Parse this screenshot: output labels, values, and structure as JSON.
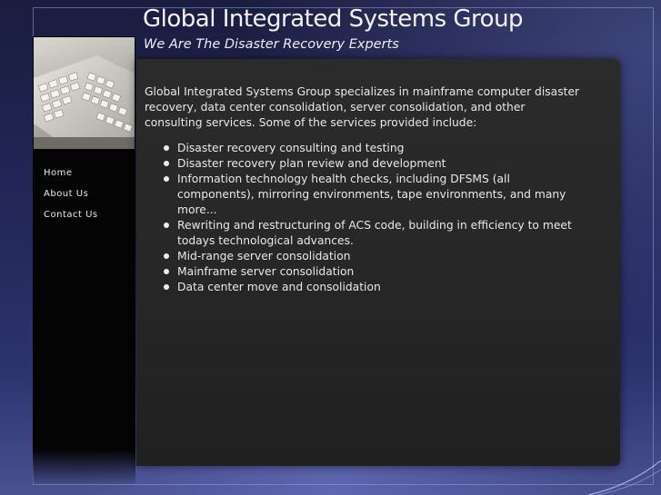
{
  "header": {
    "title": "Global Integrated Systems Group",
    "tagline": "We Are The Disaster Recovery Experts"
  },
  "sidebar": {
    "image": "keyboard-photo",
    "nav": [
      {
        "label": "Home"
      },
      {
        "label": "About Us"
      },
      {
        "label": "Contact Us"
      }
    ]
  },
  "main": {
    "intro": "Global Integrated Systems Group specializes in mainframe computer disaster recovery, data center consolidation, server consolidation, and other consulting services.  Some of the services provided include:",
    "services": [
      "Disaster recovery consulting and testing",
      "Disaster recovery plan review and development",
      "Information technology health checks, including DFSMS (all components), mirroring environments, tape environments, and many more...",
      "Rewriting and restructuring of ACS code, building in efficiency to meet todays technological advances.",
      "Mid-range server consolidation",
      "Mainframe server consolidation",
      "Data center move and consolidation"
    ]
  },
  "colors": {
    "background": "#1b1e3c",
    "panel": "#2b2b2b",
    "sidebar": "#040404",
    "text": "#e8e8e8"
  }
}
